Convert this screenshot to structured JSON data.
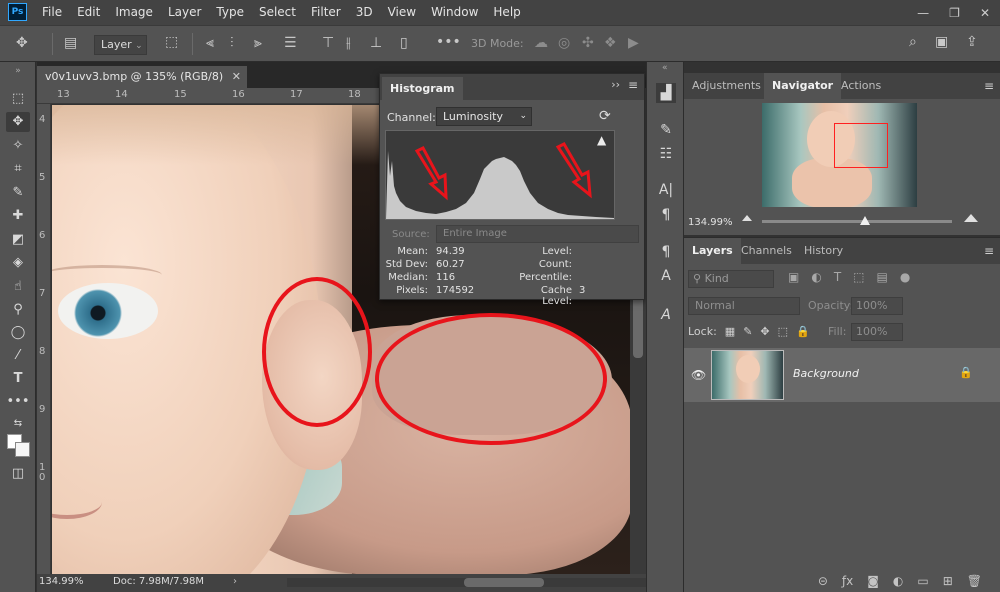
{
  "app": {
    "logo_text": "Ps"
  },
  "menu": [
    "File",
    "Edit",
    "Image",
    "Layer",
    "Type",
    "Select",
    "Filter",
    "3D",
    "View",
    "Window",
    "Help"
  ],
  "window_controls": [
    "minimize-icon",
    "restore-icon",
    "close-icon"
  ],
  "options_bar": {
    "layer_select": "Layer",
    "mode_3d_label": "3D Mode:",
    "right_icons": [
      "search-icon",
      "workspace-icon",
      "share-icon"
    ]
  },
  "document": {
    "tab_title": "v0v1uvv3.bmp @ 135% (RGB/8)",
    "zoom": "134.99%",
    "doc_size": "Doc: 7.98M/7.98M"
  },
  "rulers": {
    "top": [
      "13",
      "14",
      "15",
      "16",
      "17",
      "18"
    ],
    "left": [
      "4",
      "5",
      "6",
      "7",
      "8",
      "9",
      "1",
      "0"
    ]
  },
  "histogram": {
    "title": "Histogram",
    "channel_label": "Channel:",
    "channel_value": "Luminosity",
    "source_label": "Source:",
    "source_value": "Entire Image",
    "stats_left": [
      {
        "label": "Mean:",
        "value": "94.39"
      },
      {
        "label": "Std Dev:",
        "value": "60.27"
      },
      {
        "label": "Median:",
        "value": "116"
      },
      {
        "label": "Pixels:",
        "value": "174592"
      }
    ],
    "stats_right": [
      {
        "label": "Level:",
        "value": ""
      },
      {
        "label": "Count:",
        "value": ""
      },
      {
        "label": "Percentile:",
        "value": ""
      },
      {
        "label": "Cache Level:",
        "value": "3"
      }
    ]
  },
  "navigator_panel": {
    "tabs": [
      "Adjustments",
      "Navigator",
      "Actions"
    ],
    "active_tab": "Navigator",
    "zoom": "134.99%"
  },
  "layers_panel": {
    "tabs": [
      "Layers",
      "Channels",
      "History"
    ],
    "active_tab": "Layers",
    "kind_placeholder": "Kind",
    "blend_mode": "Normal",
    "opacity_label": "Opacity:",
    "opacity_value": "100%",
    "lock_label": "Lock:",
    "fill_label": "Fill:",
    "fill_value": "100%",
    "layers": [
      {
        "name": "Background",
        "visible": true,
        "locked": true
      }
    ]
  },
  "colors": {
    "annotation_red": "#e8141b",
    "panel_bg": "#535353",
    "app_bg": "#323232",
    "ps_blue": "#31a8ff"
  }
}
